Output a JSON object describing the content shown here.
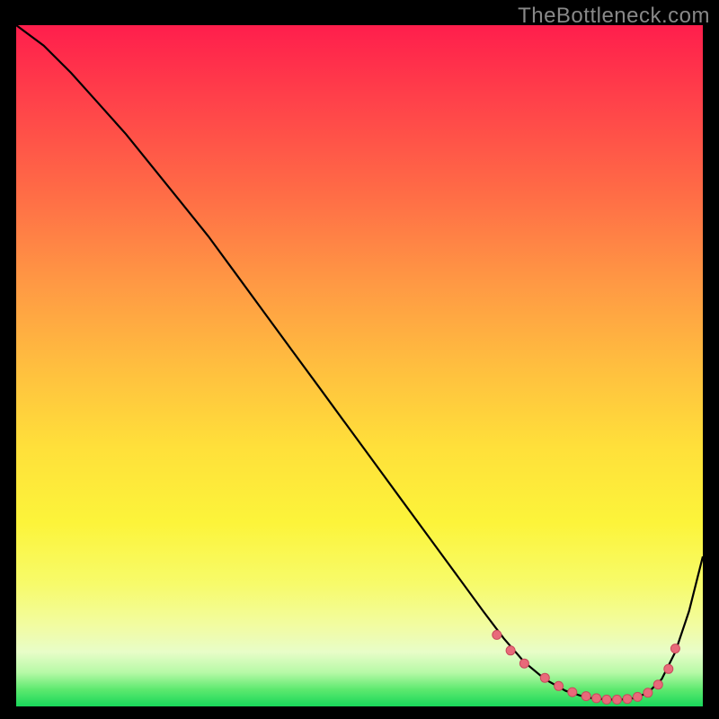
{
  "watermark": "TheBottleneck.com",
  "colors": {
    "curve_stroke": "#000000",
    "dot_fill": "#e86a7a",
    "dot_stroke": "#c94a5c"
  },
  "chart_data": {
    "type": "line",
    "title": "",
    "xlabel": "",
    "ylabel": "",
    "xlim": [
      0,
      100
    ],
    "ylim": [
      0,
      100
    ],
    "grid": false,
    "legend": false,
    "series": [
      {
        "name": "bottleneck-curve",
        "x": [
          0,
          4,
          8,
          12,
          16,
          20,
          24,
          28,
          32,
          36,
          40,
          44,
          48,
          52,
          56,
          60,
          64,
          68,
          71,
          74,
          77,
          80,
          83,
          86,
          88,
          90,
          92,
          94,
          96,
          98,
          100
        ],
        "y": [
          100,
          97,
          93,
          88.5,
          84,
          79,
          74,
          69,
          63.5,
          58,
          52.5,
          47,
          41.5,
          36,
          30.5,
          25,
          19.5,
          14,
          10,
          6.5,
          4,
          2.3,
          1.3,
          1,
          1,
          1.2,
          2,
          4,
          8,
          14,
          22
        ]
      }
    ],
    "dots": {
      "name": "highlight-dots",
      "x": [
        70,
        72,
        74,
        77,
        79,
        81,
        83,
        84.5,
        86,
        87.5,
        89,
        90.5,
        92,
        93.5,
        95,
        96
      ],
      "y": [
        10.5,
        8.2,
        6.3,
        4.2,
        3.0,
        2.1,
        1.5,
        1.2,
        1.0,
        1.0,
        1.1,
        1.4,
        2.0,
        3.2,
        5.5,
        8.5
      ]
    }
  }
}
